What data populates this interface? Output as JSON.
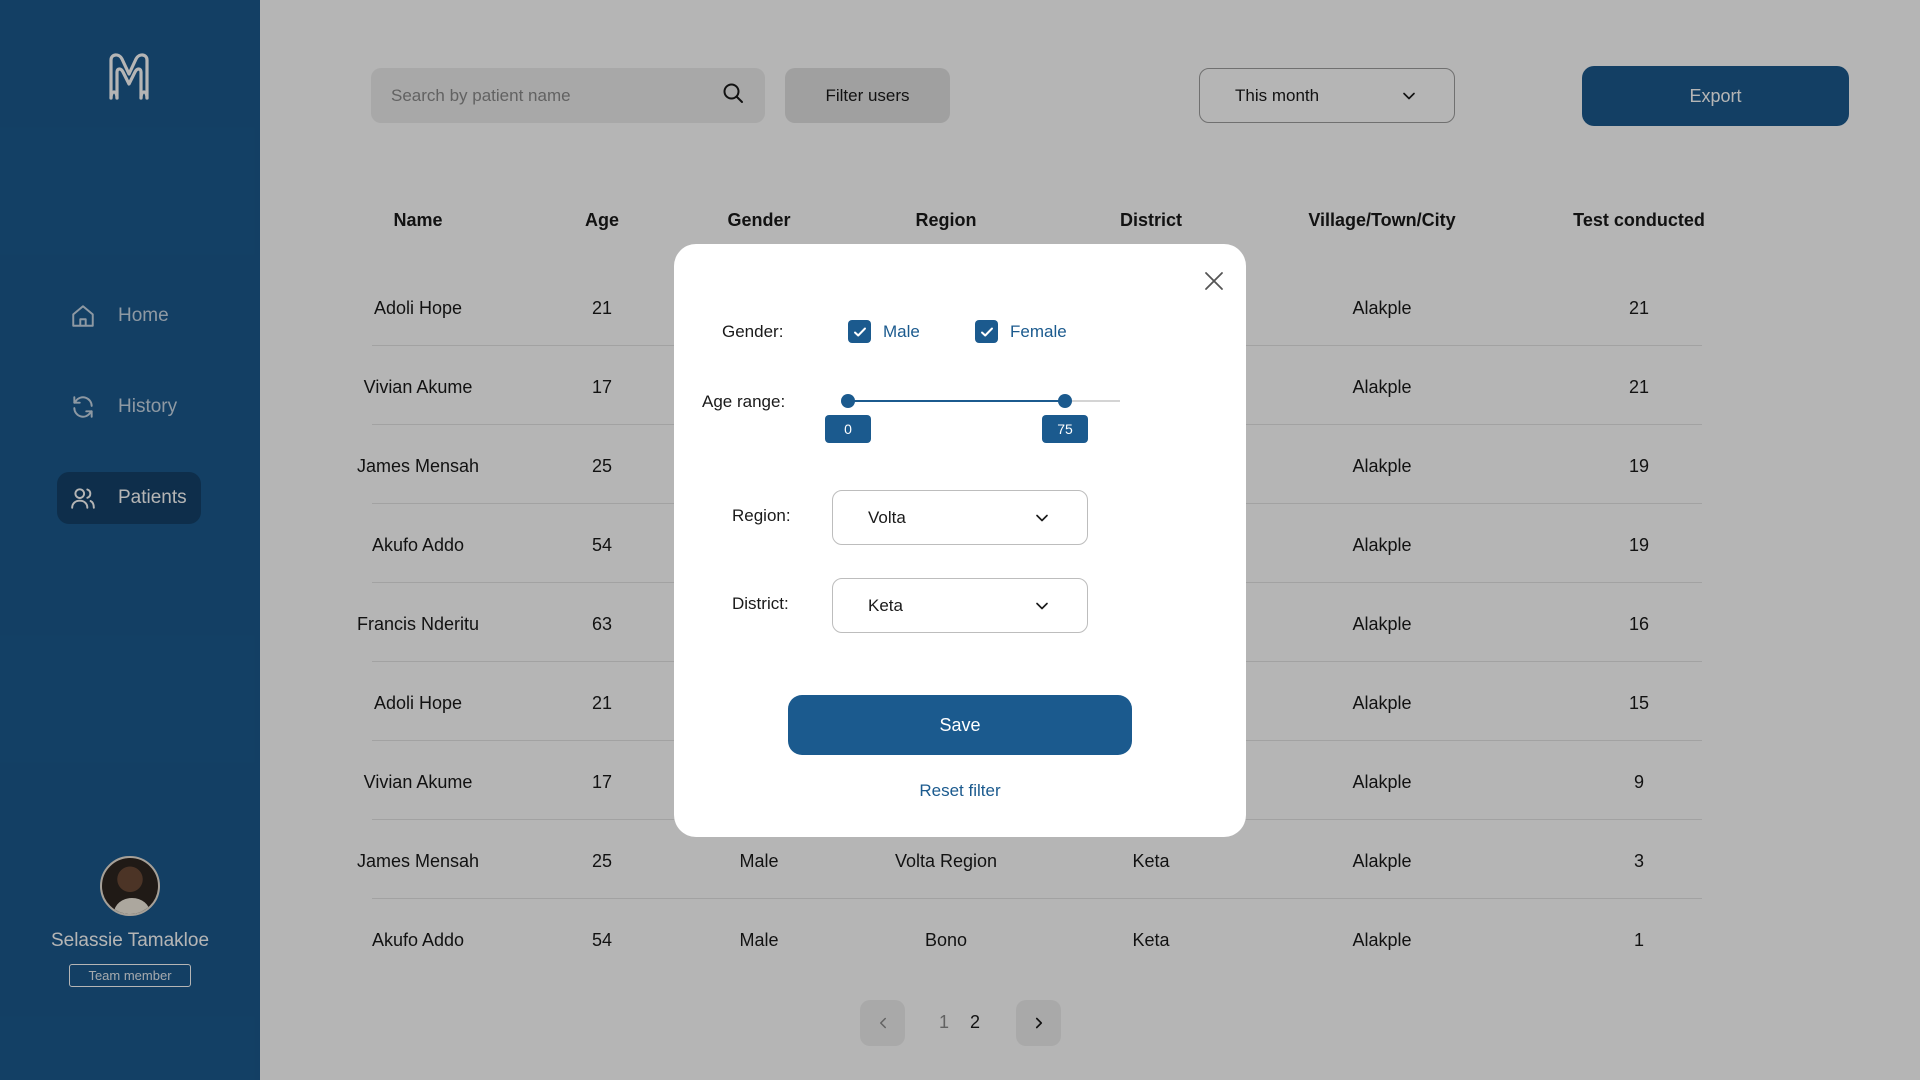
{
  "sidebar": {
    "logo_icon": "brand-logo",
    "nav": [
      {
        "label": "Home",
        "icon": "home-icon",
        "active": false
      },
      {
        "label": "History",
        "icon": "refresh-icon",
        "active": false
      },
      {
        "label": "Patients",
        "icon": "users-icon",
        "active": true
      }
    ],
    "user": {
      "name": "Selassie Tamakloe",
      "role": "Team member"
    }
  },
  "toolbar": {
    "search_placeholder": "Search by patient name",
    "filter_label": "Filter users",
    "period_value": "This month",
    "export_label": "Export"
  },
  "table": {
    "headers": [
      "Name",
      "Age",
      "Gender",
      "Region",
      "District",
      "Village/Town/City",
      "Test conducted"
    ],
    "rows": [
      {
        "name": "Adoli Hope",
        "age": "21",
        "gender": "",
        "region": "",
        "district": "",
        "village": "Alakple",
        "tests": "21"
      },
      {
        "name": "Vivian Akume",
        "age": "17",
        "gender": "",
        "region": "",
        "district": "",
        "village": "Alakple",
        "tests": "21"
      },
      {
        "name": "James Mensah",
        "age": "25",
        "gender": "",
        "region": "",
        "district": "",
        "village": "Alakple",
        "tests": "19"
      },
      {
        "name": "Akufo Addo",
        "age": "54",
        "gender": "",
        "region": "",
        "district": "",
        "village": "Alakple",
        "tests": "19"
      },
      {
        "name": "Francis Nderitu",
        "age": "63",
        "gender": "",
        "region": "",
        "district": "",
        "village": "Alakple",
        "tests": "16"
      },
      {
        "name": "Adoli Hope",
        "age": "21",
        "gender": "",
        "region": "",
        "district": "",
        "village": "Alakple",
        "tests": "15"
      },
      {
        "name": "Vivian Akume",
        "age": "17",
        "gender": "",
        "region": "",
        "district": "",
        "village": "Alakple",
        "tests": "9"
      },
      {
        "name": "James Mensah",
        "age": "25",
        "gender": "Male",
        "region": "Volta Region",
        "district": "Keta",
        "village": "Alakple",
        "tests": "3"
      },
      {
        "name": "Akufo Addo",
        "age": "54",
        "gender": "Male",
        "region": "Bono",
        "district": "Keta",
        "village": "Alakple",
        "tests": "1"
      }
    ]
  },
  "pagination": {
    "pages": [
      "1",
      "2"
    ],
    "current": "2"
  },
  "modal": {
    "gender_label": "Gender:",
    "gender_options": [
      {
        "label": "Male",
        "checked": true
      },
      {
        "label": "Female",
        "checked": true
      }
    ],
    "age_label": "Age range:",
    "age_min": 0,
    "age_max": 75,
    "age_slider_max": 94,
    "region_label": "Region:",
    "region_value": "Volta",
    "district_label": "District:",
    "district_value": "Keta",
    "save_label": "Save",
    "reset_label": "Reset filter"
  },
  "colors": {
    "primary": "#1b5a8e",
    "primary_dark": "#14426a"
  }
}
